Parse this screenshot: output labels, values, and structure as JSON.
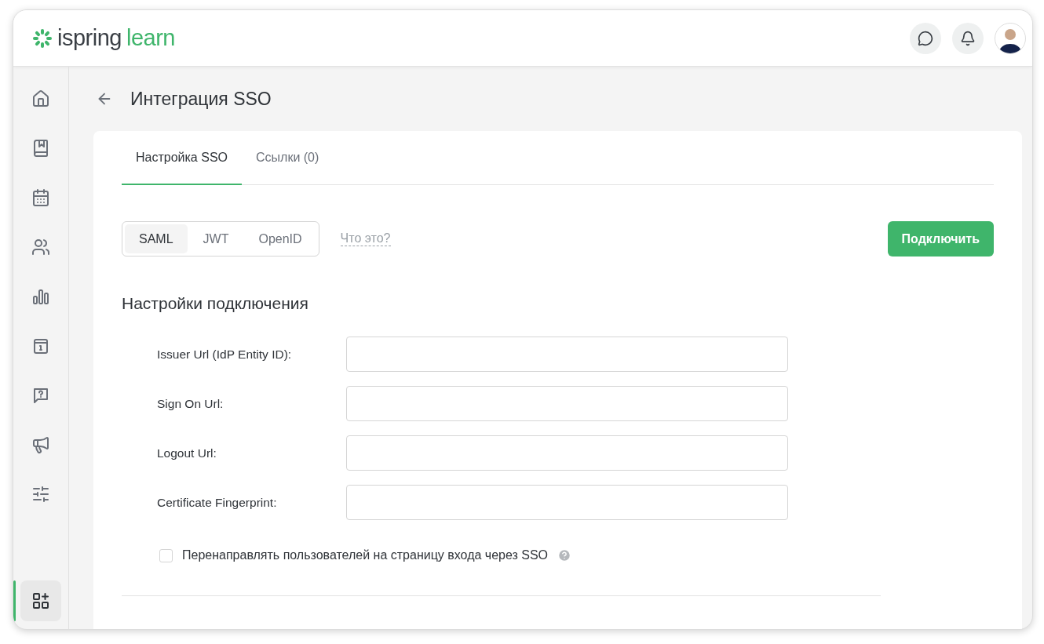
{
  "header": {
    "logo": {
      "brand": "ispring",
      "product": "learn"
    }
  },
  "sidebar": {
    "items": [
      {
        "selected": false
      },
      {
        "selected": false
      },
      {
        "selected": false
      },
      {
        "selected": false
      },
      {
        "selected": false
      },
      {
        "selected": false
      },
      {
        "selected": false
      },
      {
        "selected": false
      },
      {
        "selected": false
      },
      {
        "selected": true
      }
    ]
  },
  "page": {
    "title": "Интеграция SSO"
  },
  "tabs": [
    {
      "label": "Настройка SSO",
      "selected": true
    },
    {
      "label": "Ссылки (0)",
      "selected": false
    }
  ],
  "protocols": [
    {
      "label": "SAML",
      "selected": true
    },
    {
      "label": "JWT",
      "selected": false
    },
    {
      "label": "OpenID",
      "selected": false
    }
  ],
  "help_link": "Что это?",
  "connect_button": "Подключить",
  "section_title": "Настройки подключения",
  "fields": [
    {
      "label": "Issuer Url (IdP Entity ID):"
    },
    {
      "label": "Sign On Url:"
    },
    {
      "label": "Logout Url:"
    },
    {
      "label": "Certificate Fingerprint:"
    }
  ],
  "redirect_option": {
    "label": "Перенаправлять пользователей на страницу входа через SSO",
    "checked": false
  }
}
